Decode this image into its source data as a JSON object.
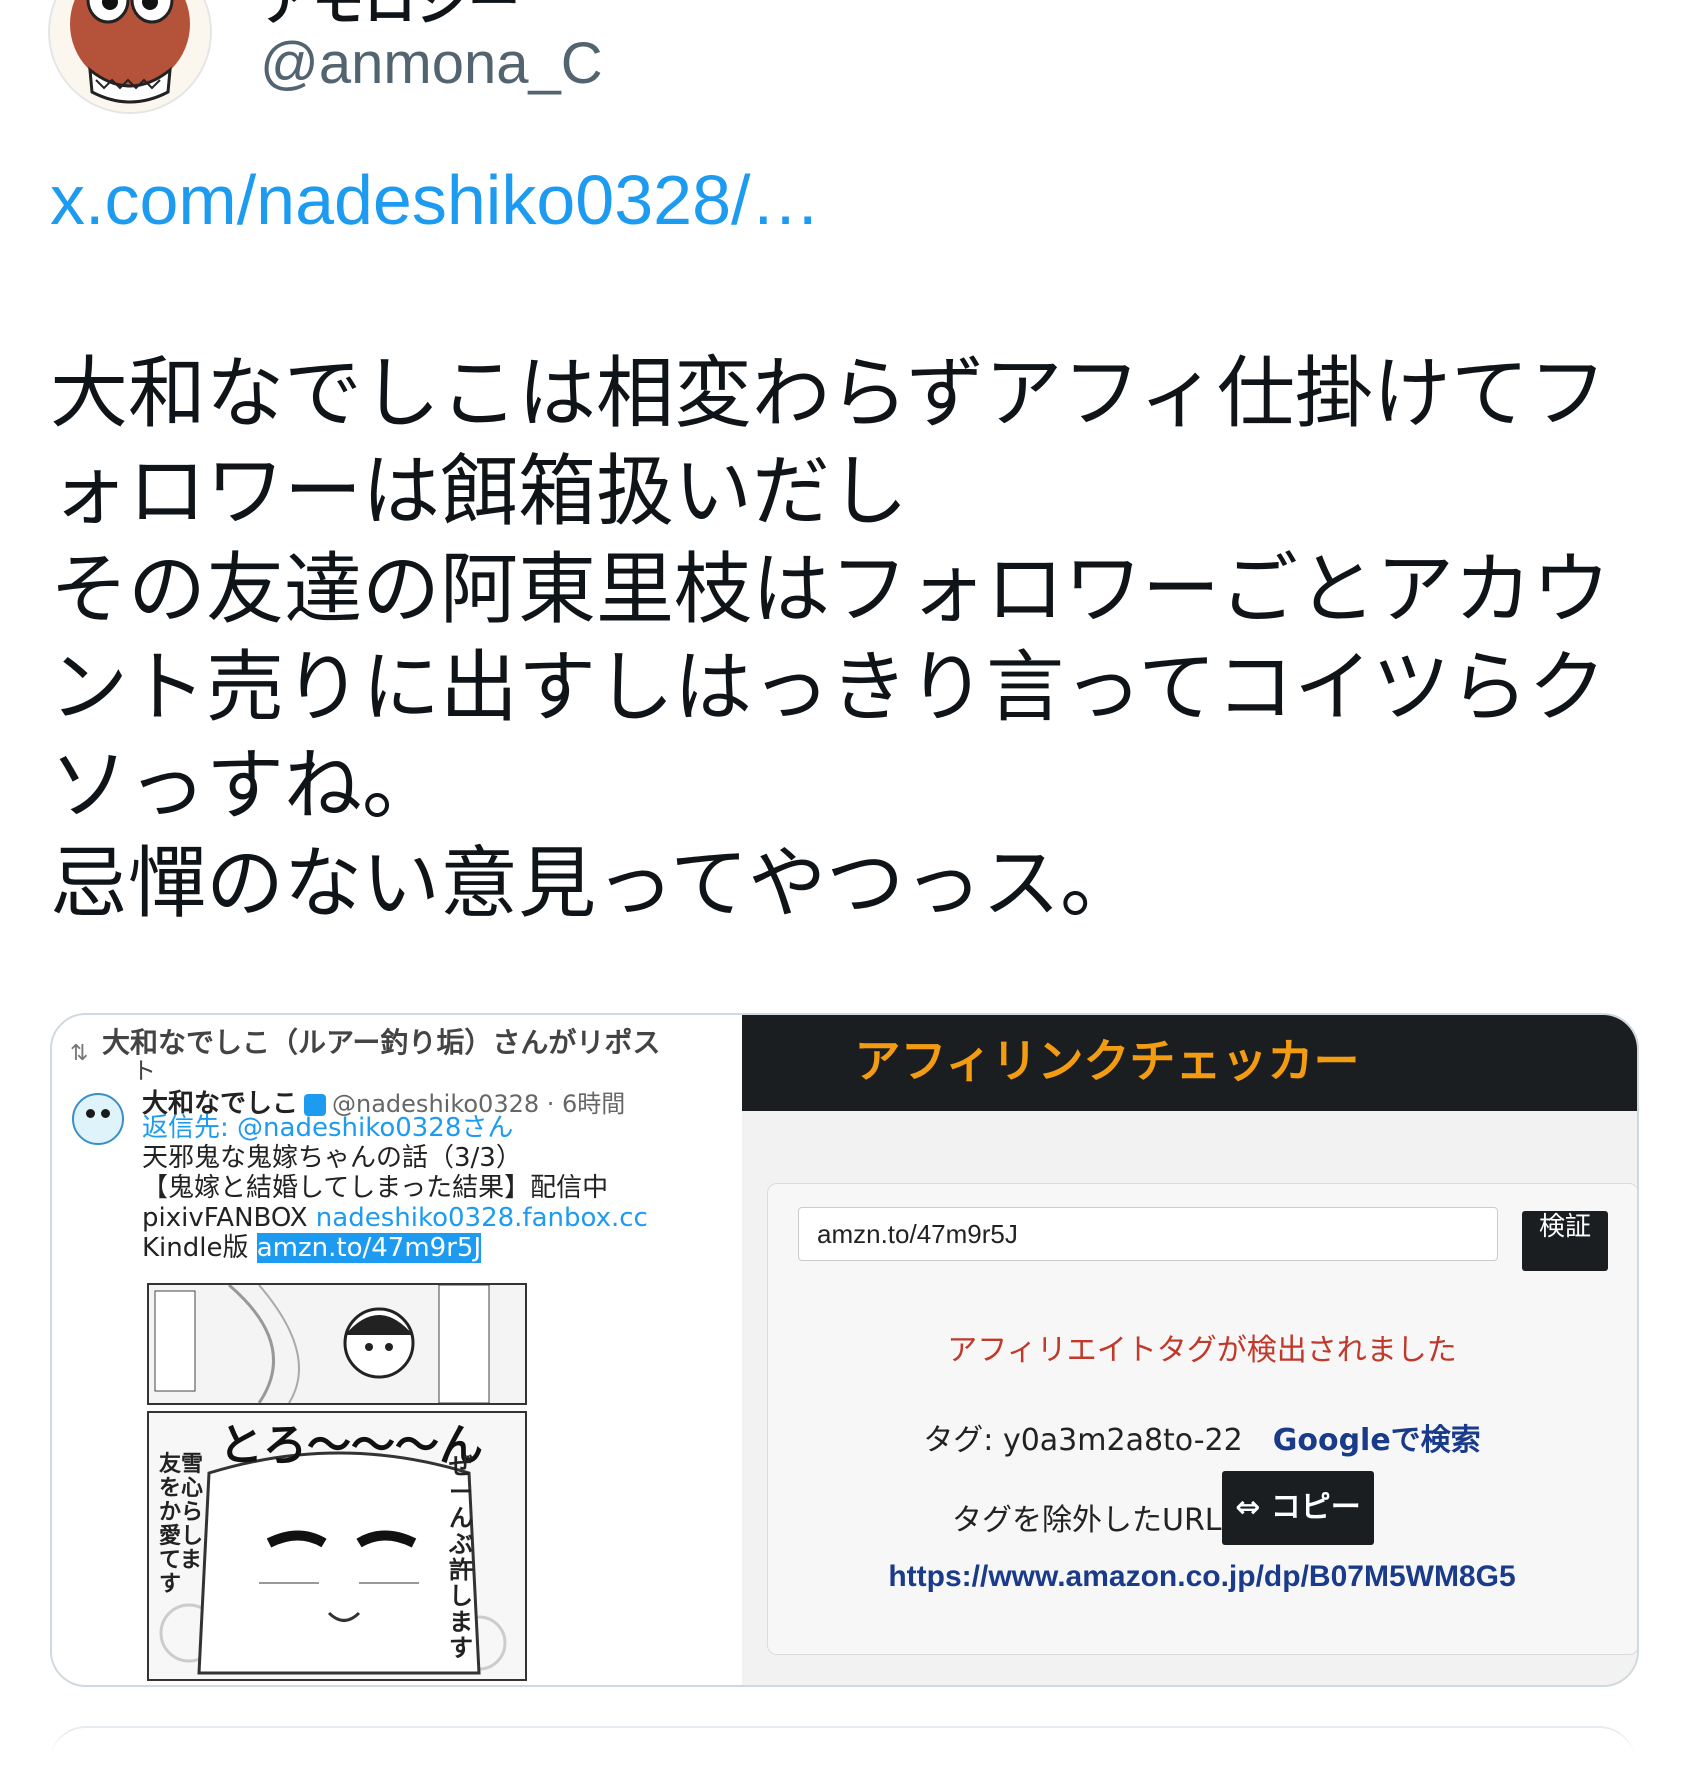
{
  "tweet": {
    "display_name": "アモロジー",
    "handle": "@anmona_C",
    "link_text": "x.com/nadeshiko0328/…",
    "text_lines": [
      "大和なでしこは相変わらずアフィ仕掛けてフ",
      "ォロワーは餌箱扱いだし",
      "その友達の阿東里枝はフォロワーごとアカウ",
      "ント売りに出すしはっきり言ってコイツらク",
      "ソっすね。",
      "忌憚のない意見ってやつっス。"
    ]
  },
  "quoted_shot": {
    "repost_label": "大和なでしこ（ルアー釣り垢）さんがリポス",
    "repost_label_cont": "ト",
    "name": "大和なでしこ",
    "handle_time": "@nadeshiko0328 · 6時間",
    "reply_to_prefix": "返信先: ",
    "reply_to_handle": "@nadeshiko0328",
    "reply_to_suffix": "さん",
    "line1": "天邪鬼な鬼嫁ちゃんの話（3/3）",
    "line2": "【鬼嫁と結婚してしまった結果】配信中",
    "fanbox_prefix": "pixivFANBOX ",
    "fanbox_link": "nadeshiko0328.fanbox.cc",
    "kindle_prefix": "Kindle版 ",
    "kindle_link": "amzn.to/47m9r5J",
    "manga_sfx": "とろ〜〜〜ん",
    "manga_text1": "ぜーんぶ許します",
    "manga_text2": "友雪を心から愛してます"
  },
  "checker": {
    "title": "アフィリンクチェッカー",
    "input_value": "amzn.to/47m9r5J",
    "check_button": "検証",
    "detected_message": "アフィリエイトタグが検出されました",
    "tag_label": "タグ: y0a3m2a8to-22",
    "google_search": "Googleで検索",
    "stripped_label": "タグを除外したURL:",
    "copy_button": "⇔ コピー",
    "clean_url": "https://www.amazon.co.jp/dp/B07M5WM8G5"
  },
  "colors": {
    "link_blue": "#1d9bf0",
    "accent_orange": "#f39c12",
    "alert_red": "#c0392b",
    "dark": "#1b1e21"
  }
}
